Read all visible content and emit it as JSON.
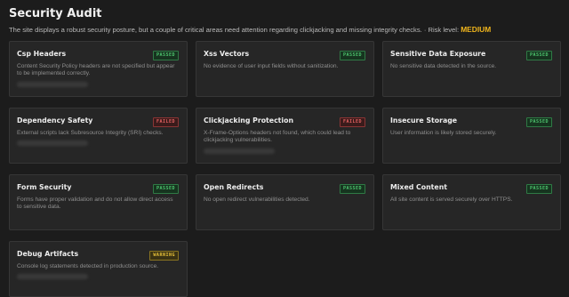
{
  "header": {
    "title": "Security Audit",
    "summary": "The site displays a robust security posture, but a couple of critical areas need attention regarding clickjacking and missing integrity checks. · Risk level:",
    "risk_level": "MEDIUM"
  },
  "colors": {
    "background": "#1c1c1c",
    "card": "#262626",
    "passed": "#4ec36e",
    "failed": "#e36262",
    "warning": "#e8c13a",
    "risk_accent": "#f0b51c"
  },
  "cards": [
    {
      "title": "Csp Headers",
      "status": "PASSED",
      "description": "Content Security Policy headers are not specified but appear to be implemented correctly."
    },
    {
      "title": "Xss Vectors",
      "status": "PASSED",
      "description": "No evidence of user input fields without sanitization."
    },
    {
      "title": "Sensitive Data Exposure",
      "status": "PASSED",
      "description": "No sensitive data detected in the source."
    },
    {
      "title": "Dependency Safety",
      "status": "FAILED",
      "description": "External scripts lack Subresource Integrity (SRI) checks."
    },
    {
      "title": "Clickjacking Protection",
      "status": "FAILED",
      "description": "X-Frame-Options headers not found, which could lead to clickjacking vulnerabilities."
    },
    {
      "title": "Insecure Storage",
      "status": "PASSED",
      "description": "User information is likely stored securely."
    },
    {
      "title": "Form Security",
      "status": "PASSED",
      "description": "Forms have proper validation and do not allow direct access to sensitive data."
    },
    {
      "title": "Open Redirects",
      "status": "PASSED",
      "description": "No open redirect vulnerabilities detected."
    },
    {
      "title": "Mixed Content",
      "status": "PASSED",
      "description": "All site content is served securely over HTTPS."
    },
    {
      "title": "Debug Artifacts",
      "status": "WARNING",
      "description": "Console log statements detected in production source."
    }
  ]
}
